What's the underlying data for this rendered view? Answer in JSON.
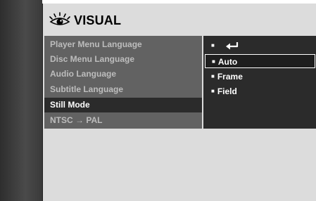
{
  "header": {
    "title": "VISUAL",
    "icon": "eye-icon"
  },
  "menu": {
    "items": [
      {
        "label": "Player Menu Language",
        "state": "normal"
      },
      {
        "label": "Disc Menu Language",
        "state": "normal"
      },
      {
        "label": "Audio Language",
        "state": "normal"
      },
      {
        "label": "Subtitle Language",
        "state": "normal"
      },
      {
        "label": "Still Mode",
        "state": "active"
      },
      {
        "label": "NTSC → PAL",
        "state": "normal"
      }
    ]
  },
  "options": {
    "return_icon": "return-arrow-icon",
    "items": [
      {
        "label": "Auto",
        "selected": true
      },
      {
        "label": "Frame",
        "selected": false
      },
      {
        "label": "Field",
        "selected": false
      }
    ],
    "bullet": "■"
  }
}
